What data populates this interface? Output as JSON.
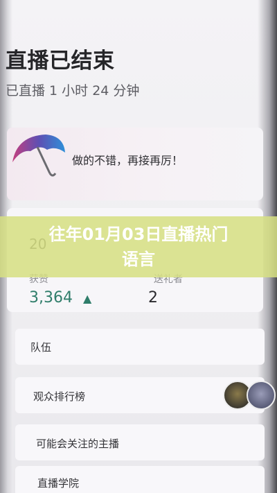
{
  "header": {
    "title": "直播已结束",
    "duration": "已直播 1 小时 24 分钟"
  },
  "praise": {
    "message": "做的不错，再接再厉！",
    "icon": "umbrella-icon"
  },
  "stats": {
    "top_value": "20",
    "likes_label": "获赞",
    "likes_value": "3,364",
    "fans_label": "送礼者",
    "fans_value": "2"
  },
  "banner": {
    "line1": "往年01月03日直播热门",
    "line2": "语言"
  },
  "menu": {
    "team": "队伍",
    "leaderboard": "观众排行榜",
    "suggested": "可能会关注的主播",
    "academy": "直播学院"
  },
  "colors": {
    "accent_green": "#2f7d6a",
    "banner_overlay": "#d6e082"
  }
}
